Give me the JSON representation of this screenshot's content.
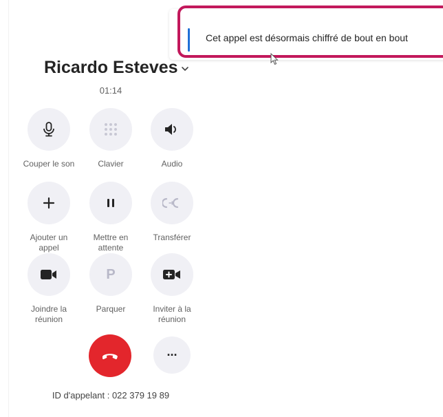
{
  "call": {
    "caller_name": "Ricardo Esteves",
    "duration": "01:14",
    "caller_id": "ID d'appelant : 022 379 19 89"
  },
  "controls": [
    {
      "label": "Couper le son",
      "icon": "microphone-icon"
    },
    {
      "label": "Clavier",
      "icon": "keypad-icon"
    },
    {
      "label": "Audio",
      "icon": "speaker-icon"
    },
    {
      "label": "Ajouter un appel",
      "icon": "plus-icon"
    },
    {
      "label": "Mettre en attente",
      "icon": "pause-icon"
    },
    {
      "label": "Transférer",
      "icon": "transfer-icon"
    },
    {
      "label": "Joindre la réunion",
      "icon": "video-camera-icon"
    },
    {
      "label": "Parquer",
      "icon": "park-icon",
      "glyph": "P"
    },
    {
      "label": "Inviter à la réunion",
      "icon": "video-add-icon"
    }
  ],
  "actions": {
    "hangup_icon": "phone-hangup-icon",
    "more_icon": "more-options-icon",
    "more_glyph": "···"
  },
  "toast": {
    "message": "Cet appel est désormais chiffré de bout en bout"
  },
  "colors": {
    "hangup": "#e3262c",
    "toast_accent": "#1f6fd6",
    "highlight": "#c2185b",
    "button_bg": "#f0f0f5"
  }
}
